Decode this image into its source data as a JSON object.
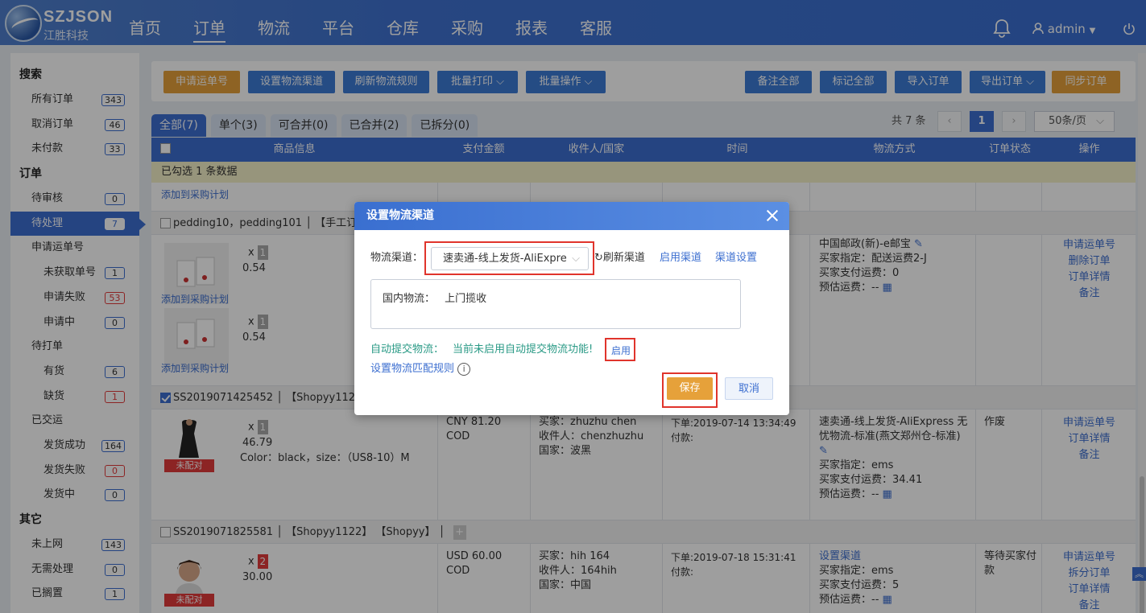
{
  "brand": {
    "name": "SZJSON",
    "sub": "江胜科技"
  },
  "nav": [
    "首页",
    "订单",
    "物流",
    "平台",
    "仓库",
    "采购",
    "报表",
    "客服"
  ],
  "user": {
    "name": "admin"
  },
  "sidebar": {
    "sections": [
      {
        "title": "搜索",
        "items": [
          {
            "label": "所有订单",
            "count": "343",
            "sub": false
          },
          {
            "label": "取消订单",
            "count": "46",
            "sub": false
          },
          {
            "label": "未付款",
            "count": "33",
            "sub": false
          }
        ]
      },
      {
        "title": "订单",
        "items": [
          {
            "label": "待审核",
            "count": "0",
            "sub": false
          },
          {
            "label": "待处理",
            "count": "7",
            "sub": false
          },
          {
            "label": "申请运单号",
            "count": "",
            "sub": false
          },
          {
            "label": "未获取单号",
            "count": "1",
            "sub": true
          },
          {
            "label": "申请失败",
            "count": "53",
            "sub": true
          },
          {
            "label": "申请中",
            "count": "0",
            "sub": true
          },
          {
            "label": "待打单",
            "count": "",
            "sub": false
          },
          {
            "label": "有货",
            "count": "6",
            "sub": true
          },
          {
            "label": "缺货",
            "count": "1",
            "sub": true
          },
          {
            "label": "已交运",
            "count": "",
            "sub": false
          },
          {
            "label": "发货成功",
            "count": "164",
            "sub": true
          },
          {
            "label": "发货失败",
            "count": "0",
            "sub": true
          },
          {
            "label": "发货中",
            "count": "0",
            "sub": true
          }
        ]
      },
      {
        "title": "其它",
        "items": [
          {
            "label": "未上网",
            "count": "143",
            "sub": false
          },
          {
            "label": "无需处理",
            "count": "0",
            "sub": false
          },
          {
            "label": "已搁置",
            "count": "1",
            "sub": false
          }
        ]
      }
    ]
  },
  "toolbar": {
    "apply_waybill": "申请运单号",
    "set_channel": "设置物流渠道",
    "refresh_rules": "刷新物流规则",
    "batch_print": "批量打印",
    "batch_ops": "批量操作",
    "remark_all": "备注全部",
    "mark_all": "标记全部",
    "import_orders": "导入订单",
    "export_orders": "导出订单",
    "sync_orders": "同步订单"
  },
  "tabs": [
    "全部(7)",
    "单个(3)",
    "可合并(0)",
    "已合并(2)",
    "已拆分(0)"
  ],
  "pager": {
    "total": "共 7 条",
    "current": "1",
    "size": "50条/页"
  },
  "table": {
    "headers": [
      "商品信息",
      "支付金额",
      "收件人/国家",
      "时间",
      "物流方式",
      "订单状态",
      "操作"
    ],
    "selected_text": "已勾选 1 条数据",
    "add_to_purchase": "添加到采购计划",
    "order1": {
      "title": "pedding10，pedding101 │ 【手工订",
      "items": [
        {
          "x": "x",
          "qty": "1",
          "price": "0.54"
        },
        {
          "x": "x",
          "qty": "1",
          "price": "0.54"
        }
      ],
      "logistics": [
        "中国邮政(新)-e邮宝",
        "买家指定：配送运费2-J",
        "买家支付运费：0",
        "预估运费：--"
      ],
      "actions": [
        "申请运单号",
        "删除订单",
        "订单详情",
        "备注"
      ]
    },
    "order2": {
      "title": "SS2019071425452 │ 【Shopyy1122",
      "item": {
        "x": "x",
        "qty": "1",
        "price": "46.79",
        "spec": "Color：black，size：（US8-10）M",
        "badge": "未配对"
      },
      "amount": [
        "CNY  81.20",
        "COD"
      ],
      "receiver": [
        "买家：zhuzhu chen",
        "收件人：chenzhuzhu",
        "国家：波黑"
      ],
      "time": [
        "下单:2019-07-14 13:34:49",
        "付款:"
      ],
      "logistics": [
        "速卖通-线上发货-AliExpress 无忧物流-标准(燕文郑州仓-标准)",
        "买家指定：ems",
        "买家支付运费：34.41",
        "预估运费：--"
      ],
      "status": "作废",
      "actions": [
        "申请运单号",
        "订单详情",
        "备注"
      ]
    },
    "order3": {
      "title": "SS2019071825581 │ 【Shopyy1122】 【Shopyy】 │",
      "item": {
        "x": "x",
        "qty": "2",
        "price": "30.00",
        "badge": "未配对"
      },
      "amount": [
        "USD  60.00",
        "COD"
      ],
      "receiver": [
        "买家：hih 164",
        "收件人：164hih",
        "国家：中国"
      ],
      "time": [
        "下单:2019-07-18 15:31:41",
        "付款:"
      ],
      "logistics": [
        "设置渠道",
        "买家指定：ems",
        "买家支付运费：5",
        "预估运费：--"
      ],
      "status": "等待买家付款",
      "actions": [
        "申请运单号",
        "拆分订单",
        "订单详情",
        "备注"
      ]
    }
  },
  "modal": {
    "title": "设置物流渠道",
    "channel_label": "物流渠道：",
    "channel_value": "速卖通-线上发货-AliExpre",
    "refresh": "刷新渠道",
    "enable_channel": "启用渠道",
    "channel_settings": "渠道设置",
    "domestic_label": "国内物流：",
    "domestic_value": "上门揽收",
    "auto_submit": "自动提交物流：",
    "auto_submit_status": "当前未启用自动提交物流功能!",
    "enable": "启用",
    "match_rules": "设置物流匹配规则",
    "save": "保存",
    "cancel": "取消"
  },
  "colors": {
    "primary": "#3d6fd0",
    "orange": "#e6a13a",
    "red": "#e0342c"
  }
}
